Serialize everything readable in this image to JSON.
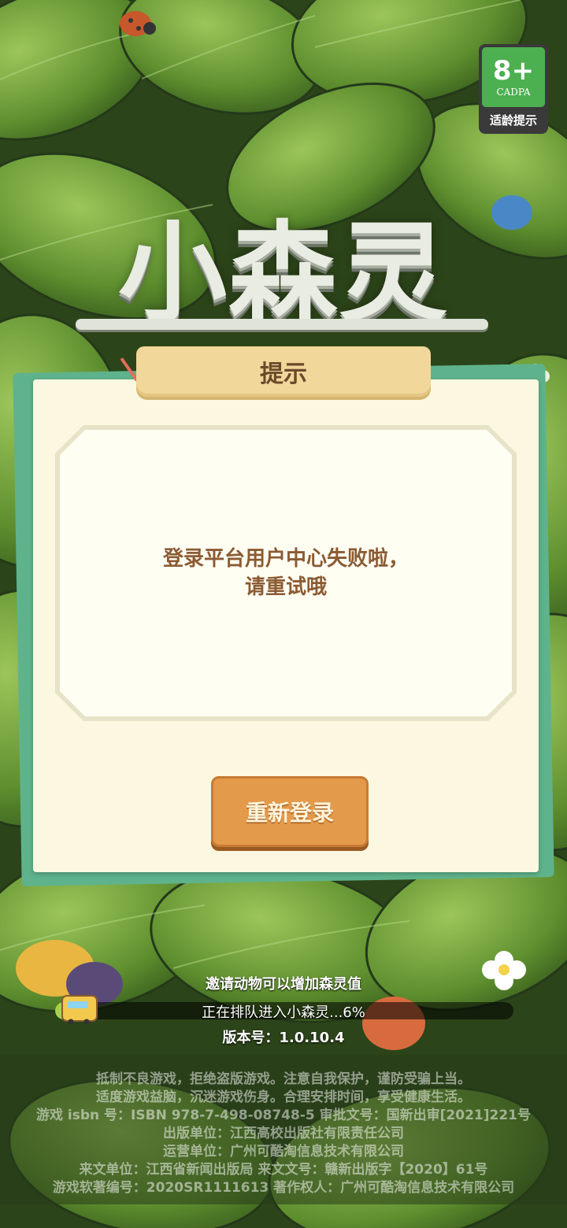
{
  "age_badge": {
    "rating": "8+",
    "org": "CADPA",
    "hint": "适龄提示"
  },
  "logo": {
    "text": "小森灵"
  },
  "dialog": {
    "title": "提示",
    "message_line1": "登录平台用户中心失败啦，",
    "message_line2": "请重试哦",
    "button_label": "重新登录"
  },
  "loading": {
    "tip": "邀请动物可以增加森灵值",
    "status": "正在排队进入小森灵...6%",
    "progress_percent": 6,
    "version": "版本号：1.0.10.4"
  },
  "footer": {
    "lines": [
      "抵制不良游戏，拒绝盗版游戏。注意自我保护，谨防受骗上当。",
      "适度游戏益脑，沉迷游戏伤身。合理安排时间，享受健康生活。",
      "游戏 isbn 号：ISBN 978-7-498-08748-5 审批文号：国新出审[2021]221号",
      "出版单位：江西高校出版社有限责任公司",
      "运营单位：广州可酷淘信息技术有限公司",
      "来文单位：江西省新闻出版局 来文文号：赣新出版字【2020】61号",
      "游戏软著编号：2020SR1111613 著作权人：广州可酷淘信息技术有限公司"
    ]
  },
  "colors": {
    "leaf_dark": "#2f4a1d",
    "leaf_light": "#7fae45",
    "dialog_bg": "#fbf7e0",
    "dialog_back": "#5fb38c",
    "title_ribbon": "#f1d79a",
    "button": "#e39a4a",
    "message_text": "#8b5b33"
  }
}
